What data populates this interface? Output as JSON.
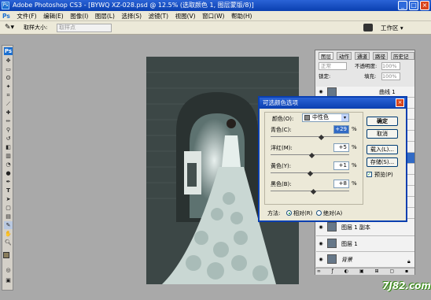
{
  "window": {
    "title": "Adobe Photoshop CS3 - [BYWQ XZ-028.psd @ 12.5% (选取颜色 1, 图层蒙版/8)]",
    "app_icon": "Ps"
  },
  "menu": [
    "文件(F)",
    "编辑(E)",
    "图像(I)",
    "图层(L)",
    "选择(S)",
    "滤镜(T)",
    "视图(V)",
    "窗口(W)",
    "帮助(H)"
  ],
  "options": {
    "sample_size_label": "取样大小:",
    "sample_size_value": "取样点",
    "workspace_label": "工作区 ▾"
  },
  "panels": {
    "tabs": [
      "图层",
      "动作",
      "通道",
      "路径",
      "历史记录"
    ],
    "blend_mode": "正常",
    "opacity_label": "不透明度:",
    "opacity_value": "100%",
    "lock_label": "锁定:",
    "fill_label": "填充:",
    "fill_value": "100%",
    "layers": [
      {
        "name": "曲线 1"
      },
      {
        "name": "图层 1 副本"
      },
      {
        "name": "图层 1"
      },
      {
        "name": "背景"
      }
    ]
  },
  "dialog": {
    "title": "可选颜色选项",
    "colors_label": "颜色(O):",
    "colors_value": "中性色",
    "sliders": [
      {
        "label": "青色(C):",
        "value": "+29",
        "pct": "%",
        "level": 0.645
      },
      {
        "label": "洋红(M):",
        "value": "+5",
        "pct": "%",
        "level": 0.525
      },
      {
        "label": "黄色(Y):",
        "value": "+1",
        "pct": "%",
        "level": 0.505
      },
      {
        "label": "黑色(B):",
        "value": "+8",
        "pct": "%",
        "level": 0.54
      }
    ],
    "buttons": [
      "确定",
      "取消",
      "载入(L)...",
      "存储(S)..."
    ],
    "preview_label": "预览(P)",
    "method_label": "方法:",
    "method_relative": "相对(R)",
    "method_absolute": "绝对(A)"
  },
  "watermark": "7J82.com",
  "colors": {
    "titlebar": "#0a3fb0",
    "accent": "#316ac5"
  }
}
